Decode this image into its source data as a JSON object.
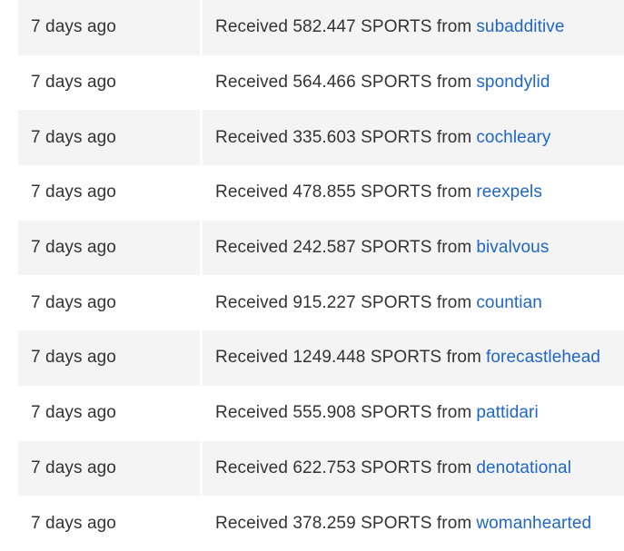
{
  "transactions": [
    {
      "time": "7 days ago",
      "text": "Received 582.447 SPORTS from",
      "user": "subadditive"
    },
    {
      "time": "7 days ago",
      "text": "Received 564.466 SPORTS from",
      "user": "spondylid"
    },
    {
      "time": "7 days ago",
      "text": "Received 335.603 SPORTS from",
      "user": "cochleary"
    },
    {
      "time": "7 days ago",
      "text": "Received 478.855 SPORTS from",
      "user": "reexpels"
    },
    {
      "time": "7 days ago",
      "text": "Received 242.587 SPORTS from",
      "user": "bivalvous"
    },
    {
      "time": "7 days ago",
      "text": "Received 915.227 SPORTS from",
      "user": "countian"
    },
    {
      "time": "7 days ago",
      "text": "Received 1249.448 SPORTS from",
      "user": "forecastlehead"
    },
    {
      "time": "7 days ago",
      "text": "Received 555.908 SPORTS from",
      "user": "pattidari"
    },
    {
      "time": "7 days ago",
      "text": "Received 622.753 SPORTS from",
      "user": "denotational"
    },
    {
      "time": "7 days ago",
      "text": "Received 378.259 SPORTS from",
      "user": "womanhearted"
    }
  ],
  "colors": {
    "link": "#1f66c7",
    "row_alt": "#f4f4f4",
    "text": "#333333"
  }
}
